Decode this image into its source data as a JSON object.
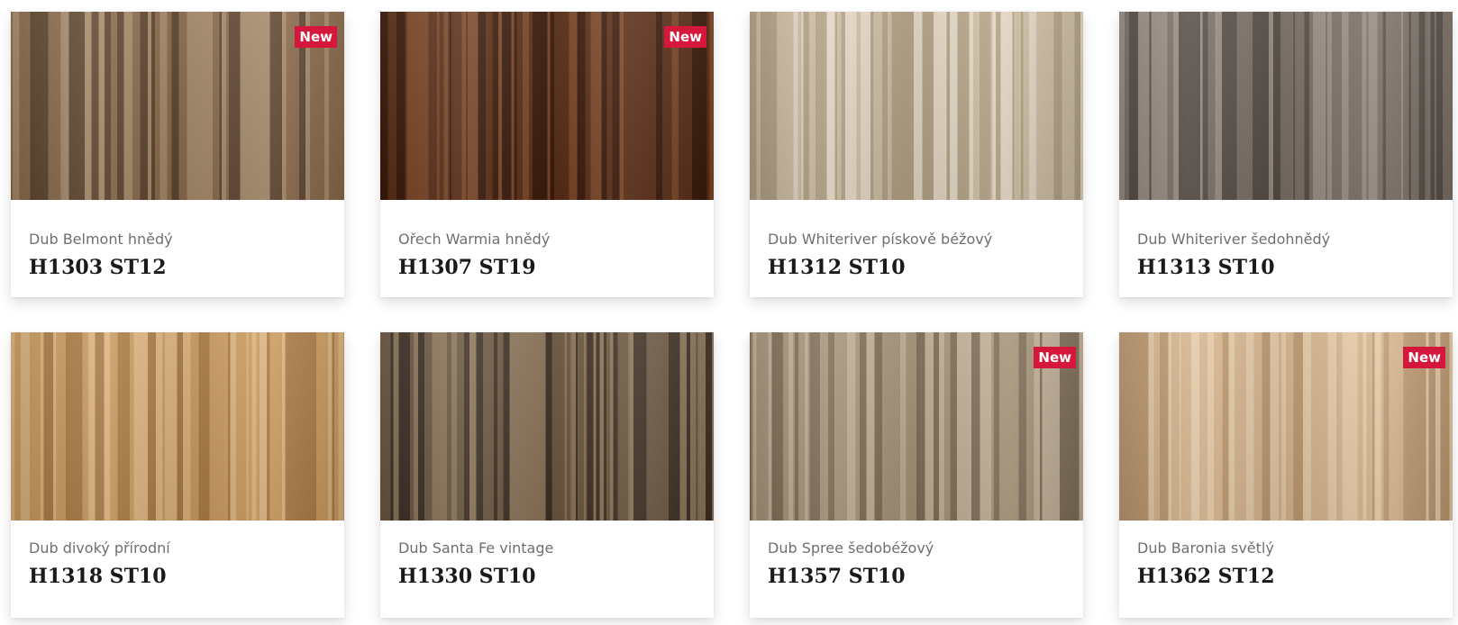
{
  "products": [
    {
      "name": "Dub Belmont hnědý",
      "code": "H1303 ST12",
      "badge": "New",
      "is_new": true,
      "colors": {
        "base": "#8a6a4b",
        "light": "#a5896a",
        "dark": "#5e4530"
      }
    },
    {
      "name": "Ořech Warmia hnědý",
      "code": "H1307 ST19",
      "badge": "New",
      "is_new": true,
      "colors": {
        "base": "#5a2e17",
        "light": "#7a4527",
        "dark": "#3a1a0a"
      }
    },
    {
      "name": "Dub Whiteriver pískově béžový",
      "code": "H1312 ST10",
      "badge": "",
      "is_new": false,
      "colors": {
        "base": "#cdbca2",
        "light": "#e3d6c3",
        "dark": "#b3a185"
      }
    },
    {
      "name": "Dub Whiteriver šedohnědý",
      "code": "H1313 ST10",
      "badge": "",
      "is_new": false,
      "colors": {
        "base": "#7a6f66",
        "light": "#978c82",
        "dark": "#564d46"
      }
    },
    {
      "name": "Dub divoký přírodní",
      "code": "H1318 ST10",
      "badge": "",
      "is_new": false,
      "colors": {
        "base": "#c9995e",
        "light": "#dbb27d",
        "dark": "#a97a43"
      }
    },
    {
      "name": "Dub Santa Fe vintage",
      "code": "H1330 ST10",
      "badge": "",
      "is_new": false,
      "colors": {
        "base": "#6b5741",
        "light": "#8a7458",
        "dark": "#3e3024"
      }
    },
    {
      "name": "Dub Spree šedobéžový",
      "code": "H1357 ST10",
      "badge": "New",
      "is_new": true,
      "colors": {
        "base": "#a69378",
        "light": "#bfae95",
        "dark": "#7f6e58"
      }
    },
    {
      "name": "Dub Baronia světlý",
      "code": "H1362 ST12",
      "badge": "New",
      "is_new": true,
      "colors": {
        "base": "#d6b48d",
        "light": "#e5c9a6",
        "dark": "#bd9870"
      }
    }
  ],
  "theme": {
    "badge_color": "#d6173c"
  }
}
